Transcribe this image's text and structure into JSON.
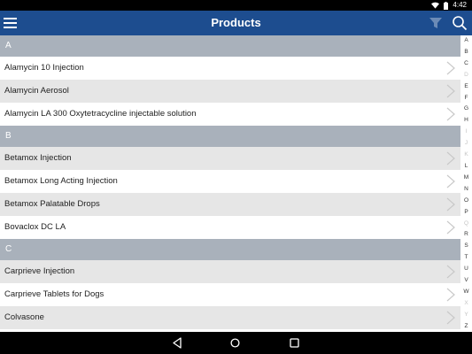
{
  "status_bar": {
    "time": "4:42",
    "icons": [
      "wifi-icon",
      "battery-icon"
    ]
  },
  "app_bar": {
    "title": "Products",
    "icons": [
      "menu-icon",
      "filter-icon",
      "search-icon"
    ],
    "color": "#1d4d8f"
  },
  "sections": [
    {
      "letter": "A",
      "items": [
        "Alamycin 10 Injection",
        "Alamycin Aerosol",
        "Alamycin LA 300 Oxytetracycline injectable solution"
      ]
    },
    {
      "letter": "B",
      "items": [
        "Betamox Injection",
        "Betamox Long Acting Injection",
        "Betamox Palatable Drops",
        "Bovaclox DC LA"
      ]
    },
    {
      "letter": "C",
      "items": [
        "Carprieve Injection",
        "Carprieve Tablets for Dogs",
        "Colvasone"
      ]
    }
  ],
  "alphabet_index": [
    {
      "letter": "A",
      "active": true
    },
    {
      "letter": "B",
      "active": true
    },
    {
      "letter": "C",
      "active": true
    },
    {
      "letter": "D",
      "active": false
    },
    {
      "letter": "E",
      "active": true
    },
    {
      "letter": "F",
      "active": true
    },
    {
      "letter": "G",
      "active": true
    },
    {
      "letter": "H",
      "active": true
    },
    {
      "letter": "I",
      "active": false
    },
    {
      "letter": "J",
      "active": false
    },
    {
      "letter": "K",
      "active": false
    },
    {
      "letter": "L",
      "active": true
    },
    {
      "letter": "M",
      "active": true
    },
    {
      "letter": "N",
      "active": true
    },
    {
      "letter": "O",
      "active": true
    },
    {
      "letter": "P",
      "active": true
    },
    {
      "letter": "Q",
      "active": false
    },
    {
      "letter": "R",
      "active": true
    },
    {
      "letter": "S",
      "active": true
    },
    {
      "letter": "T",
      "active": true
    },
    {
      "letter": "U",
      "active": true
    },
    {
      "letter": "V",
      "active": true
    },
    {
      "letter": "W",
      "active": true
    },
    {
      "letter": "X",
      "active": false
    },
    {
      "letter": "Y",
      "active": false
    },
    {
      "letter": "Z",
      "active": true
    }
  ],
  "nav_bar": {
    "icons": [
      "back-icon",
      "home-icon",
      "recents-icon"
    ]
  },
  "colors": {
    "section_header": "#a9b1bb",
    "row_alt": "#e6e6e6"
  }
}
